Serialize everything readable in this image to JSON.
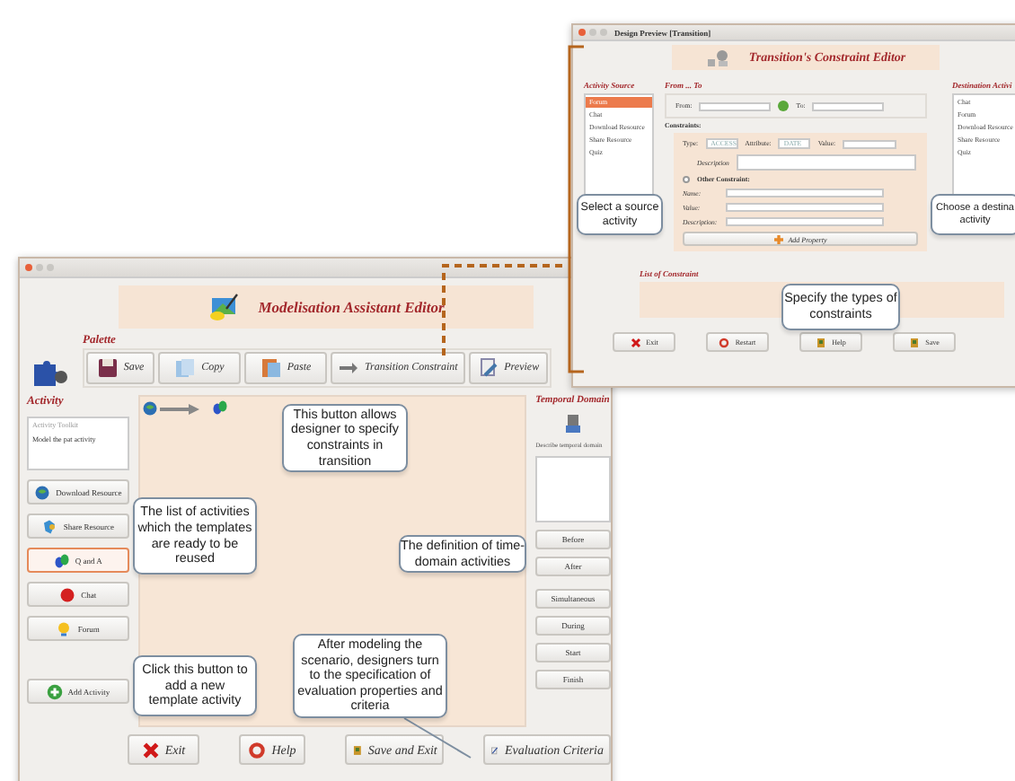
{
  "main_window": {
    "header": "Modelisation Assistant Editor",
    "palette": {
      "label": "Palette",
      "buttons": [
        "Save",
        "Copy",
        "Paste",
        "Transition Constraint",
        "Preview"
      ]
    },
    "activity": {
      "label": "Activity",
      "toolkit_title": "Activity Toolkit",
      "toolkit_text": "Model the pat activity",
      "items": [
        {
          "label": "Download Resource",
          "selected": false
        },
        {
          "label": "Share Resource",
          "selected": false
        },
        {
          "label": "Q and A",
          "selected": true
        },
        {
          "label": "Chat",
          "selected": false
        },
        {
          "label": "Forum",
          "selected": false
        }
      ],
      "add_button": "Add Activity"
    },
    "temporal_domain": {
      "label": "Temporal Domain",
      "hint": "Describe temporal domain",
      "buttons": [
        "Before",
        "After",
        "Simultaneous",
        "During",
        "Start",
        "Finish"
      ]
    },
    "bottom_buttons": [
      "Exit",
      "Help",
      "Save and Exit",
      "Evaluation Criteria"
    ]
  },
  "transition_window": {
    "title": "Design Preview [Transition]",
    "header": "Transition's Constraint Editor",
    "source": {
      "label": "Activity Source",
      "items": [
        {
          "label": "Forum",
          "selected": true
        },
        {
          "label": "Chat",
          "selected": false
        },
        {
          "label": "Download Resource",
          "selected": false
        },
        {
          "label": "Share Resource",
          "selected": false
        },
        {
          "label": "Quiz",
          "selected": false
        }
      ]
    },
    "from_to": {
      "label": "From ... To",
      "from_label": "From:",
      "to_label": "To:"
    },
    "constraints": {
      "label": "Constraints:",
      "type_label": "Type:",
      "type_value": "ACCESS",
      "attribute_label": "Attribute:",
      "attribute_value": "DATE",
      "value_label": "Value:",
      "description_label": "Description",
      "other": {
        "label": "Other Constraint:",
        "checked": false,
        "fields": [
          "Name:",
          "Value:",
          "Description:"
        ]
      },
      "add_button": "Add Property"
    },
    "destination": {
      "label": "Destination Activi",
      "items": [
        "Chat",
        "Forum",
        "Download Resource",
        "Share Resource",
        "Quiz"
      ]
    },
    "list_label": "List of Constraint",
    "buttons": [
      "Exit",
      "Restart",
      "Help",
      "Save"
    ]
  },
  "callouts": [
    {
      "lines": [
        "Select a source",
        "activity"
      ]
    },
    {
      "lines": [
        "Choose a destina",
        "activity"
      ]
    },
    {
      "lines": [
        "Specify the types of",
        "constraints"
      ]
    },
    {
      "lines": [
        "This button allows",
        "designer to specify",
        "constraints in",
        "transition"
      ]
    },
    {
      "lines": [
        "The list of activities",
        "which the templates",
        "are ready to be",
        "reused"
      ]
    },
    {
      "lines": [
        "The definition of time-",
        "domain activities"
      ]
    },
    {
      "lines": [
        "Click this button to",
        "add a new",
        "template activity"
      ]
    },
    {
      "lines": [
        "After modeling the",
        "scenario, designers turn",
        "to the specification of",
        "evaluation properties and",
        "criteria"
      ]
    }
  ]
}
